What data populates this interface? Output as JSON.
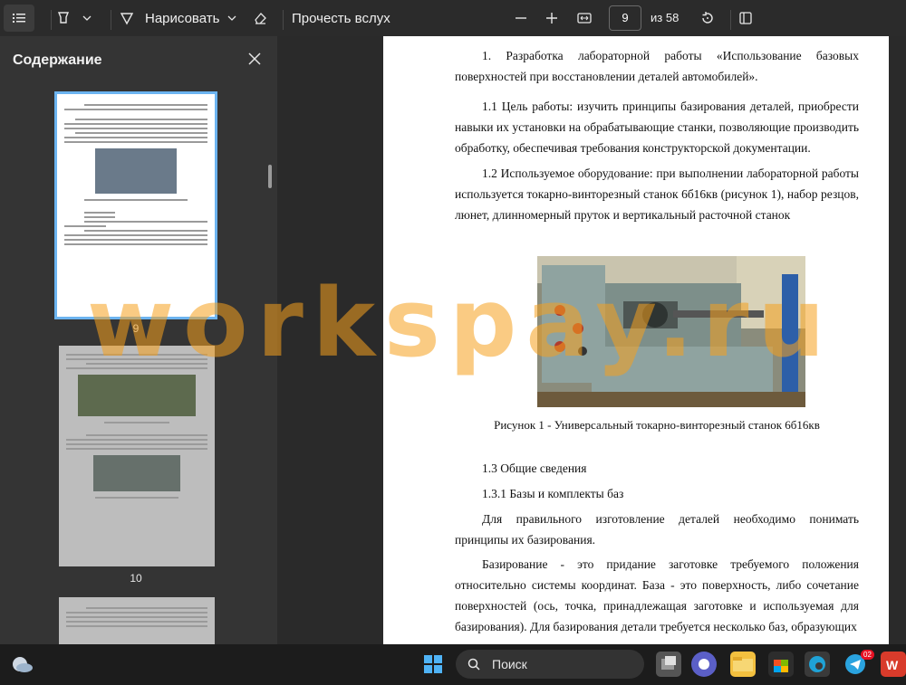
{
  "toolbar": {
    "draw_label": "Нарисовать",
    "read_aloud_label": "Прочесть вслух",
    "page_current": "9",
    "page_total": "из 58"
  },
  "sidebar": {
    "title": "Содержание",
    "thumbnails": [
      {
        "number": "9"
      },
      {
        "number": "10"
      }
    ]
  },
  "document": {
    "heading": "1. Разработка лабораторной работы «Использование базовых поверхностей при восстановлении деталей автомобилей».",
    "goal": "1.1 Цель работы: изучить принципы базирования деталей, приобрести навыки их установки на обрабатывающие станки, позволяющие производить обработку, обеспечивая требования конструкторской документации.",
    "equipment": "1.2 Используемое оборудование: при выполнении лабораторной работы используется токарно-винторезный станок 6б16кв (рисунок 1), набор резцов, люнет, длинномерный пруток и вертикальный расточной станок",
    "figure_caption": "Рисунок 1 - Универсальный токарно-винторезный станок 6б16кв",
    "section_general": "1.3 Общие сведения",
    "section_bases": "1.3.1 Базы и комплекты баз",
    "para_principles": "Для правильного изготовление деталей необходимо понимать принципы их базирования.",
    "para_definition": "Базирование - это придание заготовке требуемого положения относительно системы координат. База - это поверхность, либо сочетание поверхностей (ось, точка, принадлежащая заготовке и используемая для базирования). Для базирования детали требуется несколько баз, образующих"
  },
  "watermark": "workspay.ru",
  "taskbar": {
    "search_label": "Поиск",
    "badge": "02"
  },
  "colors": {
    "toolbar_bg": "#2b2b2b",
    "sidebar_bg": "#343434",
    "selection": "#6cb4f0",
    "watermark": "#f5a01e"
  }
}
